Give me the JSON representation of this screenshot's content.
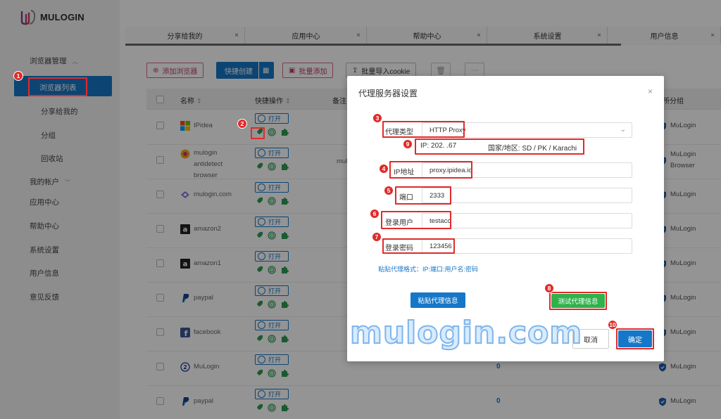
{
  "app": {
    "brand": "MULOGIN"
  },
  "sidebar": {
    "browser_mgmt": "浏览器管理",
    "items": [
      {
        "label": "浏览器列表"
      },
      {
        "label": "分享给我的"
      },
      {
        "label": "分组"
      },
      {
        "label": "回收站"
      }
    ],
    "my_account": "我的帐户",
    "app_center": "应用中心",
    "help_center": "帮助中心",
    "system_settings": "系统设置",
    "user_info": "用户信息",
    "feedback": "意见反馈"
  },
  "tabs": [
    {
      "label": "分享给我的"
    },
    {
      "label": "应用中心"
    },
    {
      "label": "帮助中心"
    },
    {
      "label": "系统设置"
    },
    {
      "label": "用户信息"
    }
  ],
  "toolbar": {
    "add_browser": "添加浏览器",
    "quick_create": "快捷创建",
    "batch_add": "批量添加",
    "batch_import_cookie": "批量导入cookie",
    "more": "···"
  },
  "table": {
    "headers": {
      "name": "名称",
      "quick_ops": "快捷操作",
      "remark": "备注",
      "group": "所分组"
    },
    "open_label": "打开",
    "remark_partial": "mul",
    "rows": [
      {
        "name": "IPidea",
        "count": "",
        "group": "MuLogin",
        "icon": "windows-icon"
      },
      {
        "name": "mulogin antidetect browser",
        "count": "",
        "group": "MuLogin Browser",
        "icon": "mulogin-icon"
      },
      {
        "name": "mulogin.com",
        "count": "",
        "group": "MuLogin",
        "icon": "globe-icon"
      },
      {
        "name": "amazon2",
        "count": "",
        "group": "MuLogin",
        "icon": "amazon-icon"
      },
      {
        "name": "amazon1",
        "count": "",
        "group": "MuLogin",
        "icon": "amazon-icon"
      },
      {
        "name": "paypal",
        "count": "",
        "group": "MuLogin",
        "icon": "paypal-icon"
      },
      {
        "name": "facebook",
        "count": "",
        "group": "MuLogin",
        "icon": "facebook-icon"
      },
      {
        "name": "MuLogin",
        "count": "0",
        "group": "MuLogin",
        "icon": "mulogin-circle-icon"
      },
      {
        "name": "paypal",
        "count": "0",
        "group": "MuLogin",
        "icon": "paypal-icon"
      }
    ]
  },
  "modal": {
    "title": "代理服务器设置",
    "close": "×",
    "proxy_type_label": "代理类型",
    "proxy_type_value": "HTTP Proxy",
    "ip_info_ip": "IP: 202.  .67",
    "ip_info_region": "国家/地区: SD / PK / Karachi",
    "ip_label": "IP地址",
    "ip_value": "proxy.ipidea.io",
    "port_label": "端口",
    "port_value": "2333",
    "user_label": "登录用户",
    "user_value": "testacc",
    "pass_label": "登录密码",
    "pass_value": "123456",
    "hint": "粘贴代理格式：IP:端口:用户名:密码",
    "paste_btn": "粘贴代理信息",
    "test_btn": "测试代理信息",
    "cancel_btn": "取消",
    "ok_btn": "确定"
  },
  "badges": [
    "1",
    "2",
    "3",
    "4",
    "5",
    "6",
    "7",
    "8",
    "9",
    "10"
  ],
  "watermark": "mulogin.com",
  "colors": {
    "primary": "#1677c8",
    "danger": "#e02b2b",
    "success": "#2fb24b"
  }
}
